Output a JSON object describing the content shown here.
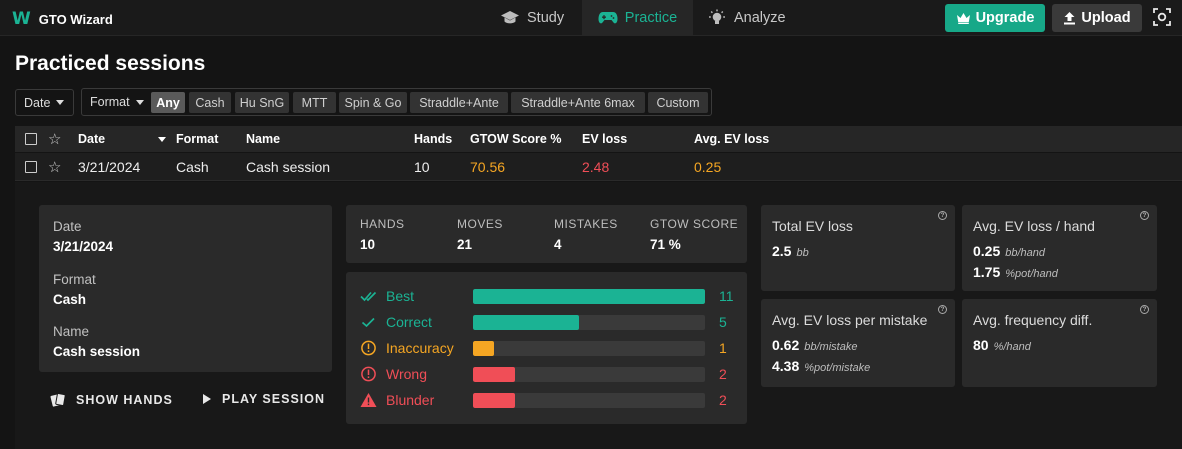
{
  "app": {
    "logo_letter": "W",
    "name": "GTO Wizard"
  },
  "nav": {
    "study": "Study",
    "practice": "Practice",
    "analyze": "Analyze",
    "upgrade": "Upgrade",
    "upload": "Upload"
  },
  "page": {
    "title": "Practiced sessions"
  },
  "filters": {
    "date_label": "Date",
    "format_label": "Format",
    "formats": [
      "Any",
      "Cash",
      "Hu SnG",
      "MTT",
      "Spin & Go",
      "Straddle+Ante",
      "Straddle+Ante 6max",
      "Custom"
    ],
    "selected_format": "Any"
  },
  "table": {
    "columns": [
      "Date",
      "Format",
      "Name",
      "Hands",
      "GTOW Score %",
      "EV loss",
      "Avg. EV loss"
    ],
    "rows": [
      {
        "date": "3/21/2024",
        "format": "Cash",
        "name": "Cash session",
        "hands": "10",
        "score": "70.56",
        "ev_loss": "2.48",
        "avg_ev_loss": "0.25"
      }
    ]
  },
  "details": {
    "date_label": "Date",
    "date_value": "3/21/2024",
    "format_label": "Format",
    "format_value": "Cash",
    "name_label": "Name",
    "name_value": "Cash session",
    "show_hands": "SHOW HANDS",
    "play_session": "PLAY SESSION",
    "stats": [
      {
        "label": "HANDS",
        "value": "10"
      },
      {
        "label": "MOVES",
        "value": "21"
      },
      {
        "label": "MISTAKES",
        "value": "4"
      },
      {
        "label": "GTOW SCORE",
        "value": "71 %"
      }
    ],
    "moves": [
      {
        "label": "Best",
        "count": "11",
        "fraction": 1.0,
        "color": "#1bb394",
        "icon": "double-check-icon"
      },
      {
        "label": "Correct",
        "count": "5",
        "fraction": 0.455,
        "color": "#1bb394",
        "icon": "check-icon"
      },
      {
        "label": "Inaccuracy",
        "count": "1",
        "fraction": 0.091,
        "color": "#f5a623",
        "icon": "info-circle-icon"
      },
      {
        "label": "Wrong",
        "count": "2",
        "fraction": 0.182,
        "color": "#f04e57",
        "icon": "exclamation-circle-icon"
      },
      {
        "label": "Blunder",
        "count": "2",
        "fraction": 0.182,
        "color": "#f04e57",
        "icon": "warning-triangle-icon"
      }
    ],
    "ev_cards": {
      "total_ev_loss": {
        "title": "Total EV loss",
        "value": "2.5",
        "unit": "bb"
      },
      "avg_ev_loss_hand": {
        "title": "Avg. EV loss / hand",
        "value1": "0.25",
        "unit1": "bb/hand",
        "value2": "1.75",
        "unit2": "%pot/hand"
      },
      "avg_ev_loss_mistake": {
        "title": "Avg. EV loss per mistake",
        "value1": "0.62",
        "unit1": "bb/mistake",
        "value2": "4.38",
        "unit2": "%pot/mistake"
      },
      "avg_freq_diff": {
        "title": "Avg. frequency diff.",
        "value": "80",
        "unit": "%/hand"
      }
    }
  },
  "colors": {
    "accent": "#1bb394",
    "score": "#f5a623",
    "loss": "#f04e57",
    "avg_loss": "#f5a623"
  }
}
